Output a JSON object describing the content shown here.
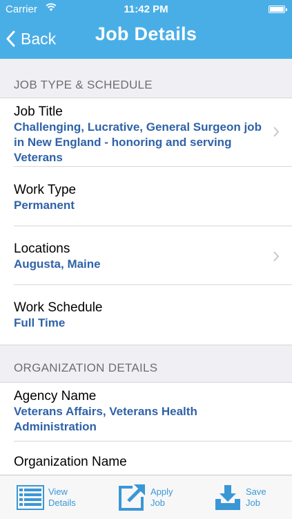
{
  "status_bar": {
    "carrier": "Carrier",
    "time": "11:42 PM",
    "icons": [
      "wifi-icon",
      "battery-icon"
    ]
  },
  "nav": {
    "back_label": "Back",
    "title": "Job Details"
  },
  "sections": [
    {
      "header": "JOB TYPE & SCHEDULE",
      "rows": [
        {
          "label": "Job Title",
          "value": "Challenging, Lucrative, General Surgeon job in New England - honoring and serving Veterans",
          "has_chevron": true
        },
        {
          "label": "Work Type",
          "value": "Permanent",
          "has_chevron": false
        },
        {
          "label": "Locations",
          "value": "Augusta, Maine",
          "has_chevron": true
        },
        {
          "label": "Work Schedule",
          "value": "Full Time",
          "has_chevron": false
        }
      ]
    },
    {
      "header": "ORGANIZATION DETAILS",
      "rows": [
        {
          "label": "Agency Name",
          "value": "Veterans Affairs, Veterans Health Administration",
          "has_chevron": false
        },
        {
          "label": "Organization Name",
          "value": "",
          "has_chevron": false
        }
      ]
    }
  ],
  "tabbar": {
    "view_details": {
      "line1": "View",
      "line2": "Details",
      "icon": "list-icon"
    },
    "apply_job": {
      "line1": "Apply",
      "line2": "Job",
      "icon": "external-link-icon"
    },
    "save_job": {
      "line1": "Save",
      "line2": "Job",
      "icon": "download-tray-icon"
    }
  },
  "colors": {
    "header_bg": "#4aaee6",
    "value_text": "#2f62a8",
    "tab_icon": "#3a97d6",
    "background": "#efeff4"
  }
}
